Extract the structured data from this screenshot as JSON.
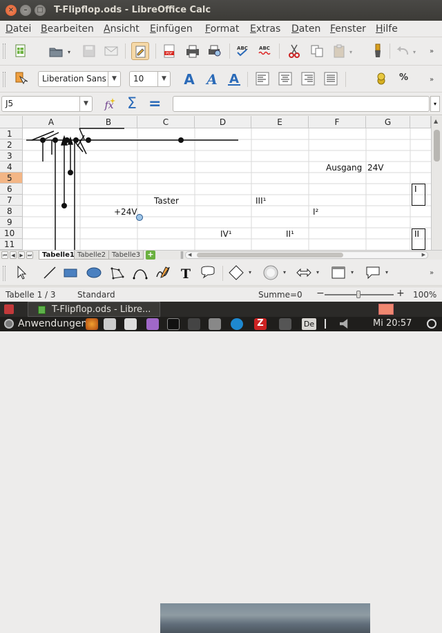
{
  "window": {
    "title": "T-Flipflop.ods - LibreOffice Calc",
    "close_glyph": "×",
    "min_glyph": "–",
    "max_glyph": "□"
  },
  "menu": [
    {
      "first": "D",
      "rest": "atei"
    },
    {
      "first": "B",
      "rest": "earbeiten"
    },
    {
      "first": "A",
      "rest": "nsicht"
    },
    {
      "first": "E",
      "rest": "infügen"
    },
    {
      "first": "F",
      "rest": "ormat"
    },
    {
      "first": "E",
      "rest": "xtras"
    },
    {
      "first": "D",
      "rest": "aten"
    },
    {
      "first": "F",
      "rest": "enster"
    },
    {
      "first": "H",
      "rest": "ilfe"
    }
  ],
  "format_bar": {
    "font_name": "Liberation Sans",
    "font_size": "10",
    "percent_label": "%"
  },
  "formula_bar": {
    "cell_ref": "J5",
    "formula_value": "",
    "sigma_label": "Σ",
    "equals_label": "="
  },
  "columns": [
    "A",
    "B",
    "C",
    "D",
    "E",
    "F",
    "G"
  ],
  "rows": [
    "1",
    "2",
    "3",
    "4",
    "5",
    "6",
    "7",
    "8",
    "9",
    "10",
    "11"
  ],
  "selected_row": "5",
  "cells": {
    "F4": "Ausgang",
    "G4": "24V",
    "C7": "Taster",
    "E7": "III¹",
    "B8": "+24V",
    "F8": "I²",
    "D10": "IV¹",
    "E10": "II¹",
    "H6_box": "I",
    "H10_box": "II"
  },
  "sheet_tabs": [
    "Tabelle1",
    "Tabelle2",
    "Tabelle3"
  ],
  "active_sheet": "Tabelle1",
  "add_sheet_label": "+",
  "status": {
    "sheet_info": "Tabelle 1 / 3",
    "page_style": "Standard",
    "sum": "Summe=0",
    "zoom_minus": "−",
    "zoom_plus": "+",
    "zoom": "100%"
  },
  "taskbar": {
    "window_label": "T-Flipflop.ods - Libre...",
    "apps_label": "Anwendungen",
    "keyboard_layout": "De",
    "clock": "Mi 20:57"
  },
  "colors": {
    "accent": "#f3b686",
    "title_bar": "#3c3b37",
    "close_button": "#e05a2a"
  }
}
